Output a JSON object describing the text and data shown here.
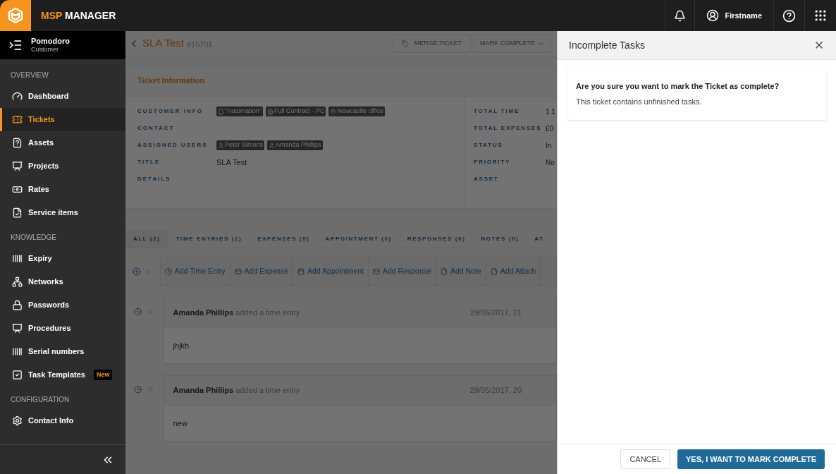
{
  "topbar": {
    "brand_accent": "MSP",
    "brand_rest": "MANAGER",
    "user": "Firstname"
  },
  "sidebar": {
    "customer": {
      "name": "Pomodoro",
      "role": "Customer"
    },
    "items": [
      {
        "kind": "section",
        "label": "OVERVIEW"
      },
      {
        "kind": "item",
        "label": "Dashboard",
        "selected": false
      },
      {
        "kind": "item",
        "label": "Tickets",
        "selected": true
      },
      {
        "kind": "item",
        "label": "Assets",
        "selected": false
      },
      {
        "kind": "item",
        "label": "Projects",
        "selected": false
      },
      {
        "kind": "item",
        "label": "Rates",
        "selected": false
      },
      {
        "kind": "item",
        "label": "Service items",
        "selected": false
      },
      {
        "kind": "section",
        "label": "KNOWLEDGE"
      },
      {
        "kind": "item",
        "label": "Expiry",
        "selected": false
      },
      {
        "kind": "item",
        "label": "Networks",
        "selected": false
      },
      {
        "kind": "item",
        "label": "Passwords",
        "selected": false
      },
      {
        "kind": "item",
        "label": "Procedures",
        "selected": false
      },
      {
        "kind": "item",
        "label": "Serial numbers",
        "selected": false
      },
      {
        "kind": "item",
        "label": "Task Templates",
        "selected": false,
        "badge": "New"
      },
      {
        "kind": "section",
        "label": "CONFIGURATION"
      },
      {
        "kind": "item",
        "label": "Contact Info",
        "selected": false
      }
    ]
  },
  "ticket": {
    "title": "SLA Test",
    "number": "#15701",
    "actions": [
      "MERGE TICKET",
      "MARK COMPLETE"
    ],
    "section_title": "Ticket Information",
    "left_fields": [
      {
        "label": "CUSTOMER INFO",
        "tags": [
          "\"Automation\"",
          "Full Contract - PC",
          "Newcastle office"
        ]
      },
      {
        "label": "CONTACT"
      },
      {
        "label": "ASSIGNED USERS",
        "tags": [
          "Peter Simons",
          "Amanda Phillips"
        ]
      },
      {
        "label": "TITLE",
        "value": "SLA Test"
      },
      {
        "label": "DETAILS"
      }
    ],
    "right_fields": [
      {
        "label": "TOTAL TIME",
        "value": "1.1"
      },
      {
        "label": "TOTAL EXPENSES",
        "value": "£0"
      },
      {
        "label": "STATUS",
        "value": "In"
      },
      {
        "label": "PRIORITY",
        "value": "No"
      },
      {
        "label": "ASSET"
      }
    ],
    "tabs": [
      {
        "label": "ALL (2)",
        "selected": true
      },
      {
        "label": "TIME ENTRIES (2)",
        "selected": false
      },
      {
        "label": "EXPENSES (0)",
        "selected": false
      },
      {
        "label": "APPOINTMENT (0)",
        "selected": false
      },
      {
        "label": "RESPONSES (0)",
        "selected": false
      },
      {
        "label": "NOTES (0)",
        "selected": false
      },
      {
        "label": "AT",
        "selected": false
      }
    ],
    "add_actions": [
      "Add Time Entry",
      "Add Expense",
      "Add Appointment",
      "Add Response",
      "Add Note",
      "Add Attach"
    ],
    "entries": [
      {
        "author": "Amanda Phillips",
        "action": "added a time entry",
        "date": "29/05/2017, 21",
        "body": "jhjkh"
      },
      {
        "author": "Amanda Phillips",
        "action": "added a time entry",
        "date": "29/05/2017, 20",
        "body": "new"
      }
    ]
  },
  "dialog": {
    "title": "Incomplete Tasks",
    "question": "Are you sure you want to mark the Ticket as complete?",
    "message": "This ticket contains unfinished tasks.",
    "buttons": [
      {
        "kind": "secondary",
        "label": "CANCEL"
      },
      {
        "kind": "primary",
        "label": "YES, I WANT TO MARK COMPLETE"
      }
    ]
  }
}
